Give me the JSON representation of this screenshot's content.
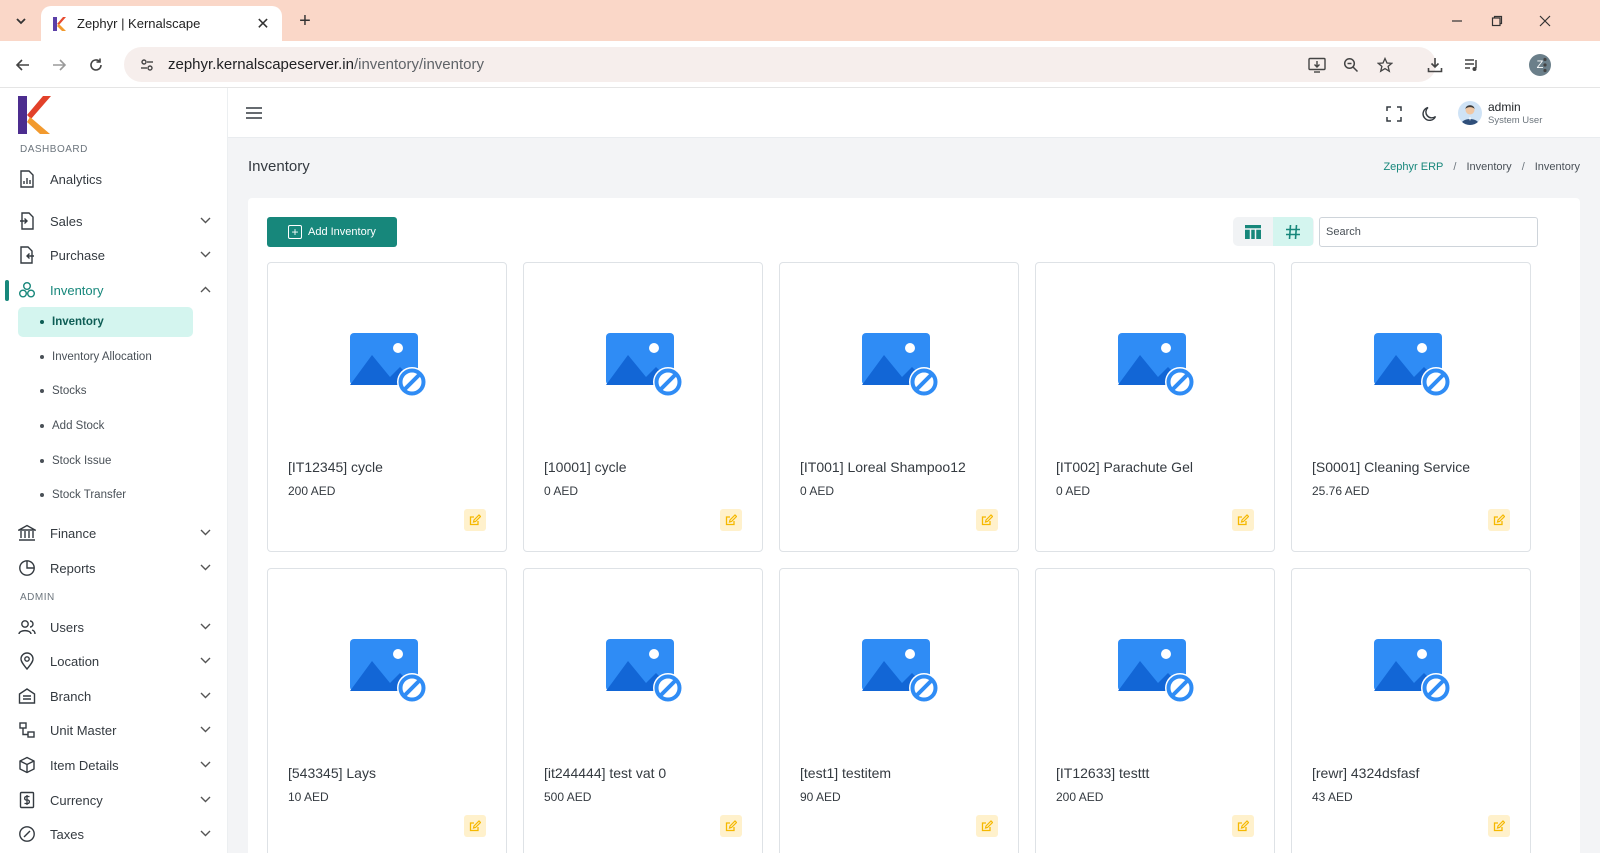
{
  "browser": {
    "tab_title": "Zephyr | Kernalscape",
    "url_domain": "zephyr.kernalscapeserver.in",
    "url_path": "/inventory/inventory",
    "profile_initial": "Z"
  },
  "sidebar": {
    "section_dashboard": "DASHBOARD",
    "section_admin": "ADMIN",
    "items": [
      {
        "label": "Analytics"
      },
      {
        "label": "Sales"
      },
      {
        "label": "Purchase"
      },
      {
        "label": "Inventory"
      },
      {
        "label": "Finance"
      },
      {
        "label": "Reports"
      },
      {
        "label": "Users"
      },
      {
        "label": "Location"
      },
      {
        "label": "Branch"
      },
      {
        "label": "Unit Master"
      },
      {
        "label": "Item Details"
      },
      {
        "label": "Currency"
      },
      {
        "label": "Taxes"
      }
    ],
    "inventory_sub": [
      {
        "label": "Inventory"
      },
      {
        "label": "Inventory Allocation"
      },
      {
        "label": "Stocks"
      },
      {
        "label": "Add Stock"
      },
      {
        "label": "Stock Issue"
      },
      {
        "label": "Stock Transfer"
      }
    ]
  },
  "header": {
    "user_name": "admin",
    "user_role": "System User"
  },
  "page": {
    "title": "Inventory",
    "breadcrumb": [
      "Zephyr ERP",
      "Inventory",
      "Inventory"
    ],
    "breadcrumb_sep": "/",
    "add_button": "Add Inventory",
    "search_placeholder": "Search"
  },
  "items": [
    {
      "name": "[IT12345] cycle",
      "price": "200 AED"
    },
    {
      "name": "[10001] cycle",
      "price": "0 AED"
    },
    {
      "name": "[IT001] Loreal Shampoo12",
      "price": "0 AED"
    },
    {
      "name": "[IT002] Parachute Gel",
      "price": "0 AED"
    },
    {
      "name": "[S0001] Cleaning Service",
      "price": "25.76 AED"
    },
    {
      "name": "[543345] Lays",
      "price": "10 AED"
    },
    {
      "name": "[it244444] test vat 0",
      "price": "500 AED"
    },
    {
      "name": "[test1] testitem",
      "price": "90 AED"
    },
    {
      "name": "[IT12633] testtt",
      "price": "200 AED"
    },
    {
      "name": "[rewr] 4324dsfasf",
      "price": "43 AED"
    }
  ],
  "colors": {
    "accent": "#17877b",
    "accent_light": "#d4f5ef",
    "edit_bg": "#fff1cc",
    "edit_icon": "#f5b800",
    "placeholder_blue": "#2f8cf5"
  }
}
